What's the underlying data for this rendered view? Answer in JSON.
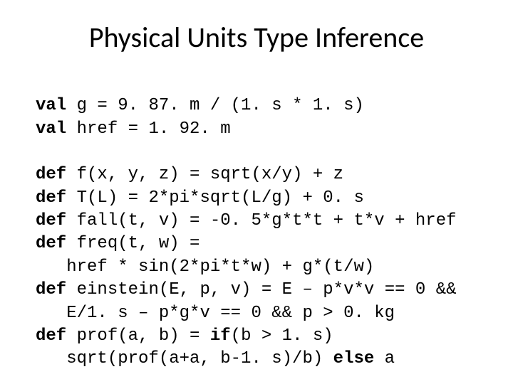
{
  "title": "Physical Units Type Inference",
  "kw": {
    "val": "val",
    "def": "def",
    "if": "if",
    "else": "else"
  },
  "code": {
    "l1a": " g = 9. 87. m / (1. s * 1. s)",
    "l2a": " href = 1. 92. m",
    "l3a": " f(x, y, z) = sqrt(x/y) + z",
    "l4a": " T(L) = 2*pi*sqrt(L/g) + 0. s",
    "l5a": " fall(t, v) = -0. 5*g*t*t + t*v + href",
    "l6a": " freq(t, w) =",
    "l6b": "   href * sin(2*pi*t*w) + g*(t/w)",
    "l7a": " einstein(E, p, v) = E – p*v*v == 0 &&",
    "l7b": "   E/1. s – p*g*v == 0 && p > 0. kg",
    "l8a": " prof(a, b) = ",
    "l8b": "(b > 1. s)",
    "l8c": "   sqrt(prof(a+a, b-1. s)/b) ",
    "l8d": " a"
  }
}
